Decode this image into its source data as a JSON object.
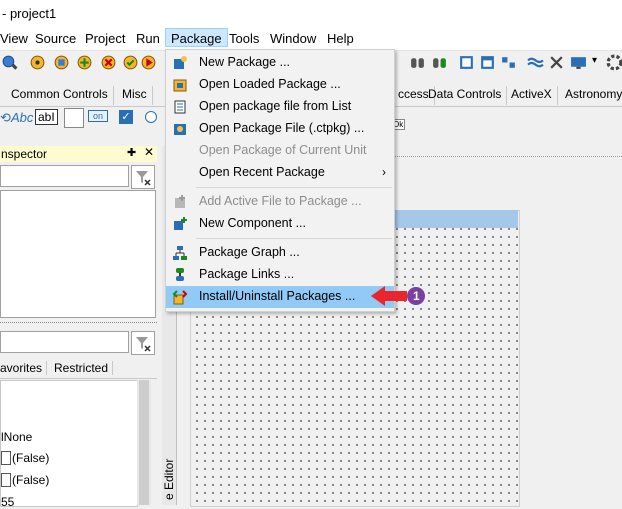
{
  "window": {
    "title": "- project1"
  },
  "menubar": [
    {
      "label": "View"
    },
    {
      "label": "Source"
    },
    {
      "label": "Project"
    },
    {
      "label": "Run"
    },
    {
      "label": "Package"
    },
    {
      "label": "Tools"
    },
    {
      "label": "Window"
    },
    {
      "label": "Help"
    }
  ],
  "palette_tabs": {
    "left": [
      "Common Controls",
      "Misc"
    ],
    "right": [
      "ccess",
      "Data Controls",
      "ActiveX",
      "Astronomy"
    ]
  },
  "components": {
    "on_label": "on",
    "abc_label": "Abc",
    "abi_label": "abI",
    "ok_label": "Ok"
  },
  "object_inspector": {
    "title": "nspector",
    "tabs": [
      "avorites",
      "Restricted"
    ],
    "values": [
      "lNone",
      "(False)",
      "(False)",
      "55"
    ]
  },
  "editor": {
    "side_label": "e Editor"
  },
  "package_menu": {
    "items": [
      {
        "label": "New Package ...",
        "disabled": false,
        "icon": "new-package-icon"
      },
      {
        "label": "Open Loaded Package ...",
        "disabled": false,
        "icon": "open-loaded-package-icon"
      },
      {
        "label": "Open package file from List",
        "disabled": false,
        "icon": "open-from-list-icon"
      },
      {
        "label": "Open Package File (.ctpkg) ...",
        "disabled": false,
        "icon": "open-package-file-icon"
      },
      {
        "label": "Open Package of Current Unit",
        "disabled": true,
        "icon": ""
      },
      {
        "label": "Open Recent Package",
        "disabled": false,
        "icon": "",
        "submenu": true
      },
      {
        "label": "Add Active File to Package ...",
        "disabled": true,
        "icon": "add-file-icon"
      },
      {
        "label": "New Component ...",
        "disabled": false,
        "icon": "new-component-icon"
      },
      {
        "label": "Package Graph ...",
        "disabled": false,
        "icon": "package-graph-icon"
      },
      {
        "label": "Package Links ...",
        "disabled": false,
        "icon": "package-links-icon"
      },
      {
        "label": "Install/Uninstall Packages ...",
        "disabled": false,
        "icon": "install-packages-icon",
        "highlighted": true
      }
    ],
    "submenu_arrow": "›"
  },
  "annotation": {
    "step_number": "1",
    "arrow_color": "#e8262b",
    "badge_color": "#7b3fa0"
  },
  "colors": {
    "highlight": "#91c9f7",
    "menu_active": "#cce8ff"
  }
}
